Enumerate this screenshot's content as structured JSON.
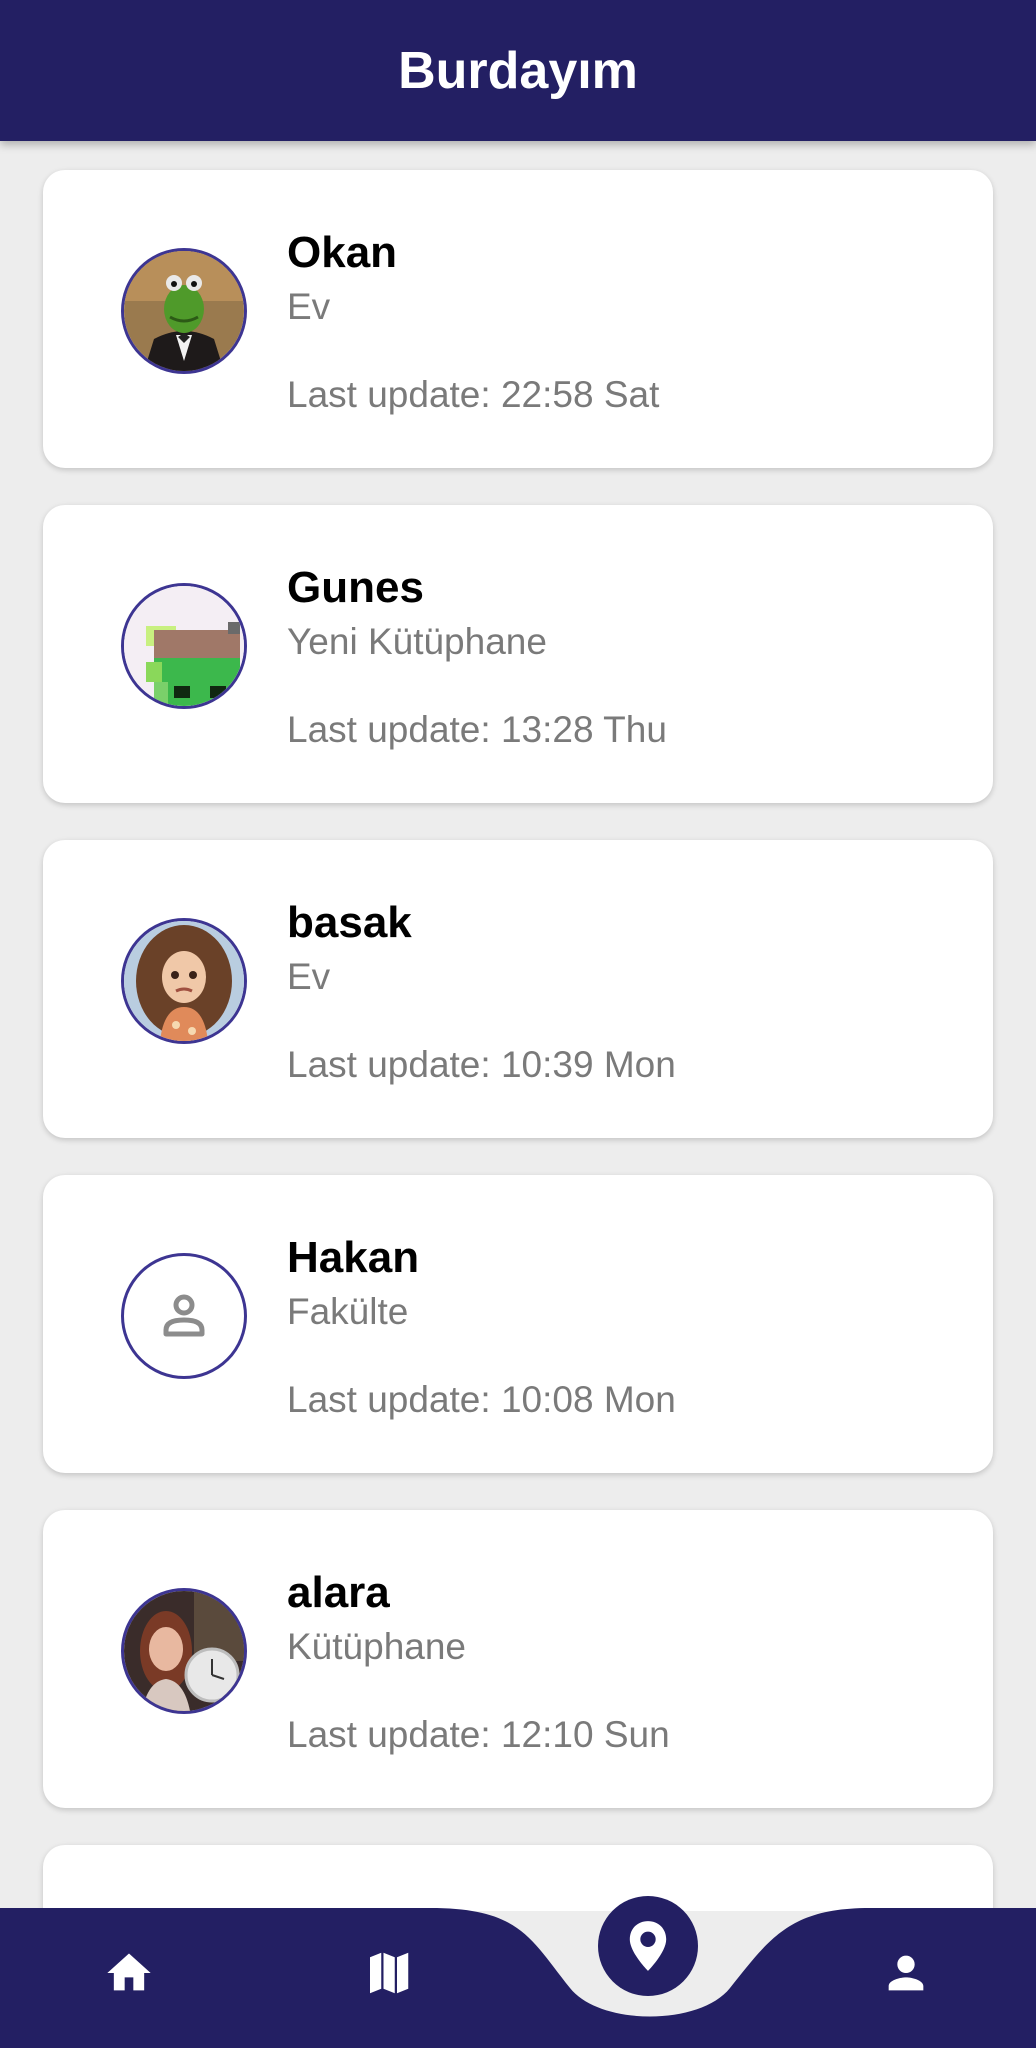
{
  "app": {
    "title": "Burdayım"
  },
  "colors": {
    "primary": "#231f63",
    "avatar_border": "#3d3592",
    "muted_text": "#7a7a7a"
  },
  "friends": [
    {
      "name": "Okan",
      "place": "Ev",
      "last_update": "Last update: 22:58 Sat",
      "avatar": "frog-photo"
    },
    {
      "name": "Gunes",
      "place": "Yeni Kütüphane",
      "last_update": "Last update: 13:28 Thu",
      "avatar": "pixel-art"
    },
    {
      "name": "basak",
      "place": "Ev",
      "last_update": "Last update: 10:39 Mon",
      "avatar": "doll-photo"
    },
    {
      "name": "Hakan",
      "place": "Fakülte",
      "last_update": "Last update: 10:08 Mon",
      "avatar": "default-person-icon"
    },
    {
      "name": "alara",
      "place": "Kütüphane",
      "last_update": "Last update: 12:10 Sun",
      "avatar": "portrait-photo"
    }
  ],
  "bottom_nav": {
    "items": [
      {
        "icon": "home-icon"
      },
      {
        "icon": "map-icon"
      },
      {
        "icon": "location-pin-icon",
        "active": true
      },
      {
        "icon": "person-icon"
      }
    ]
  }
}
